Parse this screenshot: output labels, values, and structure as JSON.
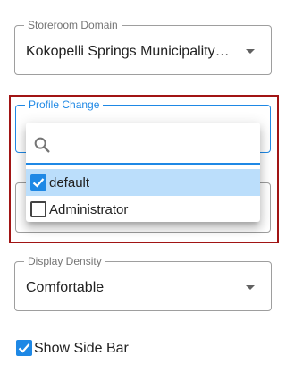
{
  "storeroom_domain": {
    "label": "Storeroom Domain",
    "value": "Kokopelli Springs Municipality S..."
  },
  "profile_change": {
    "label": "Profile Change",
    "search": {
      "value": "",
      "placeholder": ""
    },
    "options": [
      {
        "label": "default",
        "checked": true
      },
      {
        "label": "Administrator",
        "checked": false
      }
    ]
  },
  "display_density": {
    "label": "Display Density",
    "value": "Comfortable"
  },
  "show_side_bar": {
    "label": "Show Side Bar",
    "checked": true
  },
  "icons": {
    "search": "search-icon",
    "dropdown": "chevron-down-icon",
    "checkbox_checked": "checkbox-checked-icon",
    "checkbox_unchecked": "checkbox-unchecked-icon"
  },
  "colors": {
    "accent": "#1e88e5",
    "selected_row": "#bbdefb",
    "highlight_border": "#a11414",
    "field_border": "#9e9e9e"
  }
}
